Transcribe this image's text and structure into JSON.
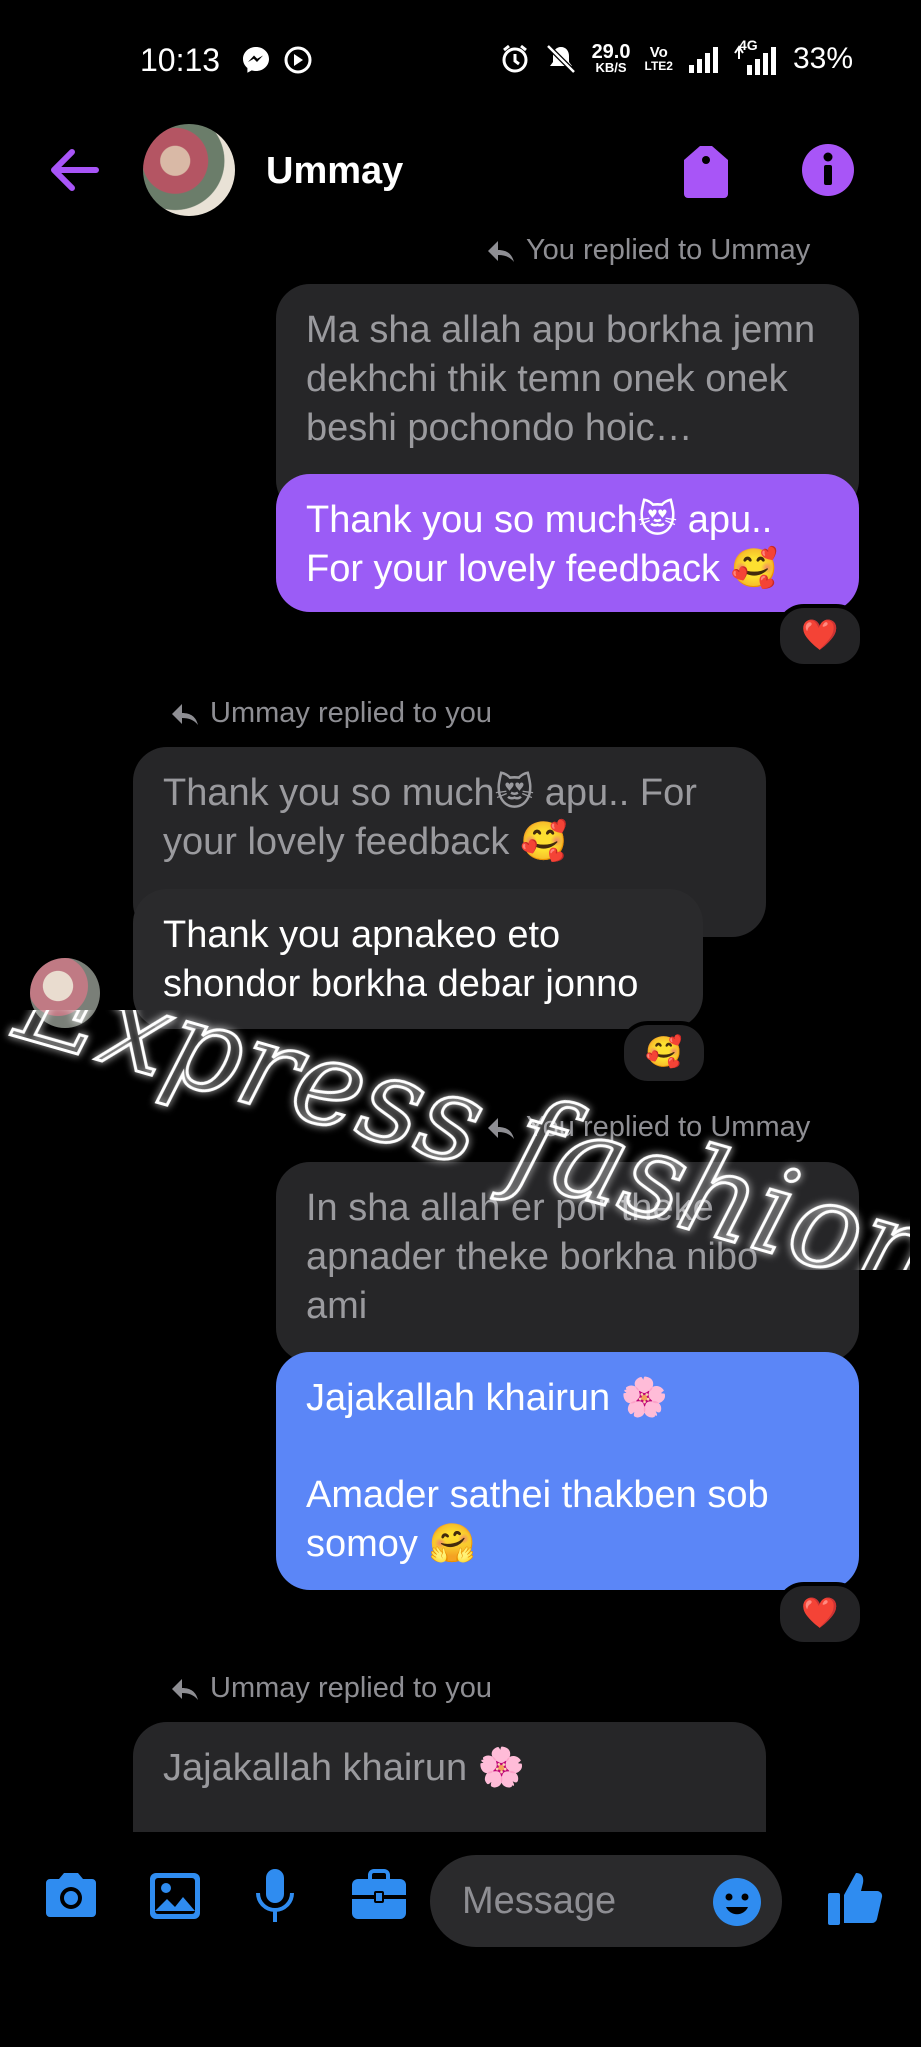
{
  "status_bar": {
    "time": "10:13",
    "net_speed_top": "29.0",
    "net_speed_bottom": "KB/S",
    "volte_top": "Vo",
    "volte_bottom": "LTE2",
    "network": "4G",
    "battery": "33%"
  },
  "header": {
    "contact_name": "Ummay"
  },
  "messages": [
    {
      "reply_label": "You replied to Ummay",
      "quoted": "Ma sha allah apu borkha jemn dekhchi thik temn onek onek beshi pochondo hoic…",
      "text": "Thank you so much😻 apu.. For your lovely feedback 🥰",
      "reaction": "❤️"
    },
    {
      "reply_label": "Ummay replied to you",
      "quoted": "Thank you so much😻 apu.. For your lovely feedback 🥰",
      "text": "Thank you apnakeo eto shondor borkha debar jonno",
      "reaction": "🥰"
    },
    {
      "reply_label": "You replied to Ummay",
      "quoted": "In sha allah er por theke apnader theke borkha nibo ami",
      "text_line1": "Jajakallah khairun 🌸",
      "text_line2": "Amader sathei thakben sob somoy 🤗",
      "reaction": "❤️"
    },
    {
      "reply_label": "Ummay replied to you",
      "quoted": "Jajakallah khairun 🌸"
    }
  ],
  "watermark": "Express fashion",
  "composer": {
    "placeholder": "Message"
  },
  "colors": {
    "accent_purple": "#a855f7",
    "bubble_purple": "#9b5cf6",
    "bubble_blue": "#5b86f7",
    "icon_blue": "#2f8cf0"
  }
}
